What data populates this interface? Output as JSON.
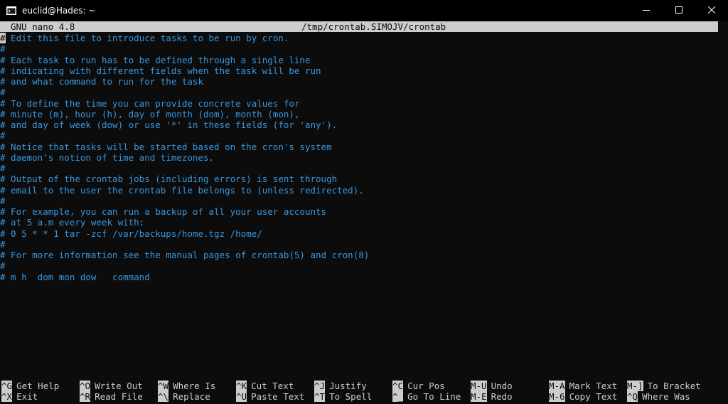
{
  "window": {
    "title": "euclid@Hades: ~",
    "controls": [
      "minimize-icon",
      "maximize-icon",
      "close-icon"
    ]
  },
  "nano": {
    "version": "GNU nano 4.8",
    "filename": "/tmp/crontab.SIMOJV/crontab"
  },
  "colors": {
    "background": "#0c0c0c",
    "text": "#3a96dd",
    "header_bg": "#cccccc",
    "shortcut_label": "#cccccc"
  },
  "content": [
    "# Edit this file to introduce tasks to be run by cron.",
    "#",
    "# Each task to run has to be defined through a single line",
    "# indicating with different fields when the task will be run",
    "# and what command to run for the task",
    "#",
    "# To define the time you can provide concrete values for",
    "# minute (m), hour (h), day of month (dom), month (mon),",
    "# and day of week (dow) or use '*' in these fields (for 'any').",
    "#",
    "# Notice that tasks will be started based on the cron's system",
    "# daemon's notion of time and timezones.",
    "#",
    "# Output of the crontab jobs (including errors) is sent through",
    "# email to the user the crontab file belongs to (unless redirected).",
    "#",
    "# For example, you can run a backup of all your user accounts",
    "# at 5 a.m every week with:",
    "# 0 5 * * 1 tar -zcf /var/backups/home.tgz /home/",
    "#",
    "# For more information see the manual pages of crontab(5) and cron(8)",
    "#",
    "# m h  dom mon dow   command"
  ],
  "shortcuts": {
    "row1": [
      {
        "key": "^G",
        "label": "Get Help"
      },
      {
        "key": "^O",
        "label": "Write Out"
      },
      {
        "key": "^W",
        "label": "Where Is"
      },
      {
        "key": "^K",
        "label": "Cut Text"
      },
      {
        "key": "^J",
        "label": "Justify"
      },
      {
        "key": "^C",
        "label": "Cur Pos"
      },
      {
        "key": "M-U",
        "label": "Undo"
      },
      {
        "key": "M-A",
        "label": "Mark Text"
      },
      {
        "key": "M-]",
        "label": "To Bracket"
      }
    ],
    "row2": [
      {
        "key": "^X",
        "label": "Exit"
      },
      {
        "key": "^R",
        "label": "Read File"
      },
      {
        "key": "^\\",
        "label": "Replace"
      },
      {
        "key": "^U",
        "label": "Paste Text"
      },
      {
        "key": "^T",
        "label": "To Spell"
      },
      {
        "key": "^_",
        "label": "Go To Line"
      },
      {
        "key": "M-E",
        "label": "Redo"
      },
      {
        "key": "M-6",
        "label": "Copy Text"
      },
      {
        "key": "^Q",
        "label": "Where Was"
      }
    ]
  }
}
